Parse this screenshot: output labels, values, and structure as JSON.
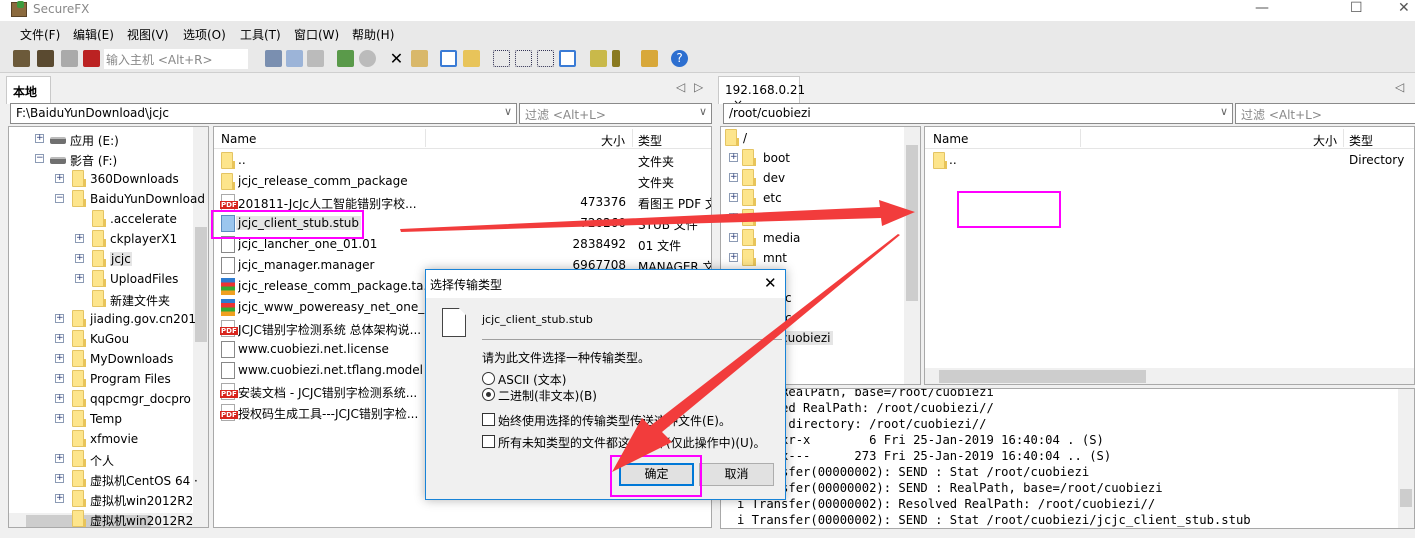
{
  "app": {
    "title": "SecureFX",
    "win_min": "—",
    "win_max": "☐",
    "win_close": "✕"
  },
  "menu": [
    "文件(F)",
    "编辑(E)",
    "视图(V)",
    "选项(O)",
    "工具(T)",
    "窗口(W)",
    "帮助(H)"
  ],
  "toolbar": {
    "host_placeholder": "输入主机 <Alt+R>"
  },
  "local": {
    "tab": "本地",
    "tab_close": "×",
    "path": "F:\\BaiduYunDownload\\jcjc",
    "filter_placeholder": "过滤 <Alt+L>",
    "tree": [
      {
        "label": "应用 (E:)",
        "depth": 0,
        "exp": "+",
        "kind": "drive"
      },
      {
        "label": "影音 (F:)",
        "depth": 0,
        "exp": "−",
        "kind": "drive"
      },
      {
        "label": "360Downloads",
        "depth": 1,
        "exp": "+"
      },
      {
        "label": "BaiduYunDownload",
        "depth": 1,
        "exp": "−"
      },
      {
        "label": ".accelerate",
        "depth": 2,
        "exp": ""
      },
      {
        "label": "ckplayerX1",
        "depth": 2,
        "exp": "+"
      },
      {
        "label": "jcjc",
        "depth": 2,
        "exp": "+",
        "selected": true
      },
      {
        "label": "UploadFiles",
        "depth": 2,
        "exp": "+"
      },
      {
        "label": "新建文件夹",
        "depth": 2,
        "exp": ""
      },
      {
        "label": "jiading.gov.cn201",
        "depth": 1,
        "exp": "+"
      },
      {
        "label": "KuGou",
        "depth": 1,
        "exp": "+"
      },
      {
        "label": "MyDownloads",
        "depth": 1,
        "exp": "+"
      },
      {
        "label": "Program Files",
        "depth": 1,
        "exp": "+"
      },
      {
        "label": "qqpcmgr_docpro",
        "depth": 1,
        "exp": "+"
      },
      {
        "label": "Temp",
        "depth": 1,
        "exp": "+"
      },
      {
        "label": "xfmovie",
        "depth": 1,
        "exp": ""
      },
      {
        "label": "个人",
        "depth": 1,
        "exp": "+"
      },
      {
        "label": "虚拟机CentOS 64 ·",
        "depth": 1,
        "exp": "+"
      },
      {
        "label": "虚拟机win2012R2",
        "depth": 1,
        "exp": "+"
      },
      {
        "label": "虚拟机win2012R2",
        "depth": 1,
        "exp": ""
      }
    ],
    "columns": {
      "name": "Name",
      "size": "大小",
      "type": "类型"
    },
    "files": [
      {
        "name": "..",
        "size": "",
        "type": "文件夹",
        "icon": "folder"
      },
      {
        "name": "jcjc_release_comm_package",
        "size": "",
        "type": "文件夹",
        "icon": "folder"
      },
      {
        "name": "201811-JcJc人工智能错别字校...",
        "size": "473376",
        "type": "看图王 PDF 文",
        "icon": "pdf"
      },
      {
        "name": "jcjc_client_stub.stub",
        "size": "720260",
        "type": "STUB 文件",
        "icon": "stub",
        "selected": true
      },
      {
        "name": "jcjc_lancher_one_01.01",
        "size": "2838492",
        "type": "01 文件",
        "icon": "file"
      },
      {
        "name": "jcjc_manager.manager",
        "size": "6967708",
        "type": "MANAGER 文",
        "icon": "file"
      },
      {
        "name": "jcjc_release_comm_package.ta...",
        "size": "",
        "type": "",
        "icon": "rar"
      },
      {
        "name": "jcjc_www_powereasy_net_one_...",
        "size": "",
        "type": "",
        "icon": "rar"
      },
      {
        "name": "JCJC错别字检测系统 总体架构说...",
        "size": "",
        "type": "",
        "icon": "pdf"
      },
      {
        "name": "www.cuobiezi.net.license",
        "size": "",
        "type": "",
        "icon": "file"
      },
      {
        "name": "www.cuobiezi.net.tflang.model",
        "size": "",
        "type": "",
        "icon": "file"
      },
      {
        "name": "安装文档 - JCJC错别字检测系统...",
        "size": "",
        "type": "",
        "icon": "pdf"
      },
      {
        "name": "授权码生成工具---JCJC错别字检...",
        "size": "",
        "type": "",
        "icon": "pdf"
      }
    ]
  },
  "remote": {
    "tab": "192.168.0.21",
    "tab_close": "×",
    "path": "/root/cuobiezi",
    "filter_placeholder": "过滤 <Alt+L>",
    "tree": [
      {
        "label": "/",
        "root": true
      },
      {
        "label": "boot"
      },
      {
        "label": "dev"
      },
      {
        "label": "etc"
      },
      {
        "label": ""
      },
      {
        "label": "media"
      },
      {
        "label": "mnt"
      },
      {
        "label": ""
      },
      {
        "label": "c",
        "shift": true
      },
      {
        "label": "c",
        "shift": true
      },
      {
        "label": "cuobiezi",
        "selected": true,
        "shift2": true
      }
    ],
    "columns": {
      "name": "Name",
      "size": "大小",
      "type": "类型"
    },
    "files": [
      {
        "name": "..",
        "type": "Directory"
      }
    ]
  },
  "log": [
    "      RealPath, base=/root/cuobiezi",
    "      ed RealPath: /root/cuobiezi//",
    "       directory: /root/cuobiezi//",
    "      xr-x        6 Fri 25-Jan-2019 16:40:04 . (S)",
    "      x---      273 Fri 25-Jan-2019 16:40:04 .. (S)",
    "i Transfer(00000002): SEND : Stat /root/cuobiezi",
    "i Transfer(00000002): SEND : RealPath, base=/root/cuobiezi",
    "i Transfer(00000002): Resolved RealPath: /root/cuobiezi//",
    "i Transfer(00000002): SEND : Stat /root/cuobiezi/jcjc_client_stub.stub"
  ],
  "dialog": {
    "title": "选择传输类型",
    "close": "✕",
    "filename": "jcjc_client_stub.stub",
    "prompt": "请为此文件选择一种传输类型。",
    "opt_ascii": "ASCII (文本)",
    "opt_binary": "二进制(非文本)(B)",
    "selected": "binary",
    "chk_always": "始终使用选择的传输类型传送这种文件(E)。",
    "chk_all": "所有未知类型的文件都这样操作(仅此操作中)(U)。",
    "ok": "确定",
    "cancel": "取消"
  },
  "colors": {
    "annotation_box": "#ff00ff",
    "annotation_arrow": "#f23c3c",
    "dialog_border": "#1883d7"
  }
}
